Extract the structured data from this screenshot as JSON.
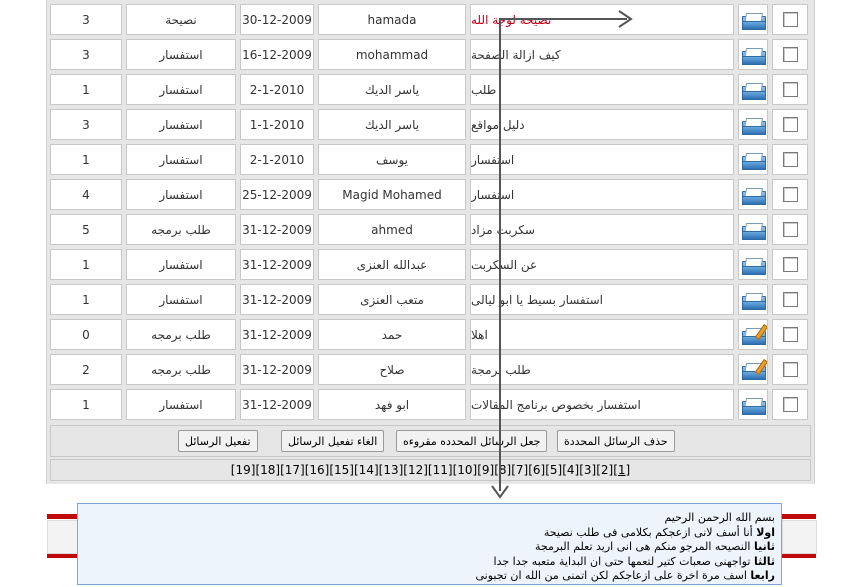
{
  "rows": [
    {
      "count": "3",
      "type": "نصيحة",
      "date": "30-12-2009",
      "user": "hamada",
      "subject": "نصيحة لوجة الله",
      "red": true,
      "icon": "envelope-icon"
    },
    {
      "count": "3",
      "type": "استفسار",
      "date": "16-12-2009",
      "user": "mohammad",
      "subject": "كيف ازالة الصفحة",
      "red": false,
      "icon": "envelope-icon"
    },
    {
      "count": "1",
      "type": "استفسار",
      "date": "2-1-2010",
      "user": "ياسر الديك",
      "subject": "طلب",
      "red": false,
      "icon": "envelope-icon"
    },
    {
      "count": "3",
      "type": "استفسار",
      "date": "1-1-2010",
      "user": "ياسر الديك",
      "subject": "دليل مواقع",
      "red": false,
      "icon": "envelope-icon"
    },
    {
      "count": "1",
      "type": "استفسار",
      "date": "2-1-2010",
      "user": "يوسف",
      "subject": "استفسار",
      "red": false,
      "icon": "envelope-icon"
    },
    {
      "count": "4",
      "type": "استفسار",
      "date": "25-12-2009",
      "user": "Magid Mohamed",
      "subject": "استفسار",
      "red": false,
      "icon": "envelope-icon"
    },
    {
      "count": "5",
      "type": "طلب برمجه",
      "date": "31-12-2009",
      "user": "ahmed",
      "subject": "سكربت مزاد",
      "red": false,
      "icon": "envelope-icon"
    },
    {
      "count": "1",
      "type": "استفسار",
      "date": "31-12-2009",
      "user": "عبدالله العنزى",
      "subject": "عن السكربت",
      "red": false,
      "icon": "envelope-icon"
    },
    {
      "count": "1",
      "type": "استفسار",
      "date": "31-12-2009",
      "user": "متعب العنزى",
      "subject": "استفسار بسيط يا ابو ليالى",
      "red": false,
      "icon": "envelope-icon"
    },
    {
      "count": "0",
      "type": "طلب برمجه",
      "date": "31-12-2009",
      "user": "حمد",
      "subject": "اهلا",
      "red": false,
      "icon": "envelope-pen-icon"
    },
    {
      "count": "2",
      "type": "طلب برمجه",
      "date": "31-12-2009",
      "user": "صلاح",
      "subject": "طلب برمجة",
      "red": false,
      "icon": "envelope-pen-icon"
    },
    {
      "count": "1",
      "type": "استفسار",
      "date": "31-12-2009",
      "user": "ابو فهد",
      "subject": "استفسار بخصوص برنامج المقالات",
      "red": false,
      "icon": "envelope-icon"
    }
  ],
  "buttons": {
    "delete": "حذف الرسائل المحددة",
    "mark_read": "جعل الرسائل المحدده مقروءه",
    "unactivate": "الغاء تفعيل الرسائل",
    "activate": "تفعيل الرسائل"
  },
  "pager": {
    "pages": [
      "[19]",
      "[18]",
      "[17]",
      "[16]",
      "[15]",
      "[14]",
      "[13]",
      "[12]",
      "[11]",
      "[10]",
      "[9]",
      "[8]",
      "[7]",
      "[6]",
      "[5]",
      "[4]",
      "[3]",
      "[2]",
      "[1]"
    ],
    "current": "[1]"
  },
  "note": {
    "line1": "بسم الله الرحمن الرحيم",
    "l2_bold": "اولا",
    "l2_text": " أنا أسف لانى ازعجكم بكلامى فى طلب نصيحة",
    "l3_bold": "ثانيا",
    "l3_text": " النصيحه المرجو منكم هى انى اريد تعلم البرمجة",
    "l4_bold": "ثالثا",
    "l4_text": " تواجهنى صعبات كتير لتعمها حتى ان البداية متعبه جدا جدا",
    "l5_bold": "رابعا",
    "l5_text": " اسف مرة اخرة على ازعاجكم لكن اتمنى من الله ان تجبونى"
  },
  "colors": {
    "accent_red": "#c00a0a",
    "note_bg": "#eef4fb",
    "note_border": "#7aa7d6"
  }
}
